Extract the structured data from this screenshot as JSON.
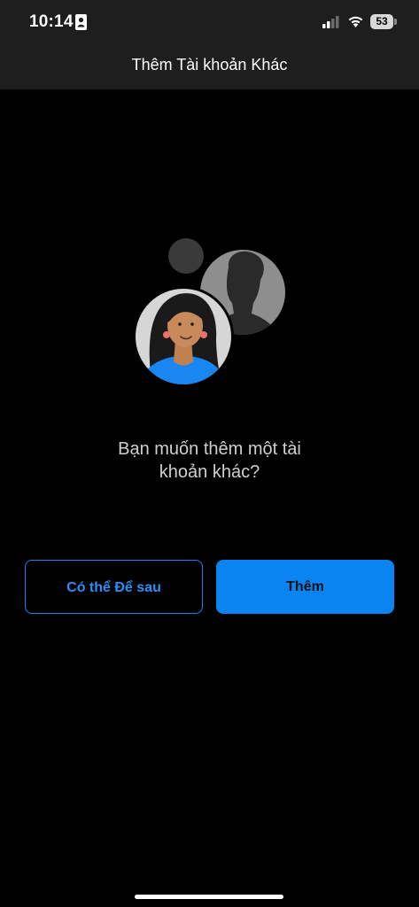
{
  "status_bar": {
    "time": "10:14",
    "battery_level": "53",
    "icons": [
      "contact-card-icon",
      "cellular-signal-icon",
      "wifi-icon",
      "battery-icon"
    ]
  },
  "header": {
    "title": "Thêm Tài khoản Khác"
  },
  "main": {
    "illustration": "accounts-avatars-illustration",
    "prompt": "Bạn muốn thêm một tài khoản khác?"
  },
  "actions": {
    "later_label": "Có thể Để sau",
    "add_label": "Thêm"
  },
  "colors": {
    "background": "#000000",
    "header_background": "#1e1e1e",
    "accent": "#0a84f0"
  }
}
